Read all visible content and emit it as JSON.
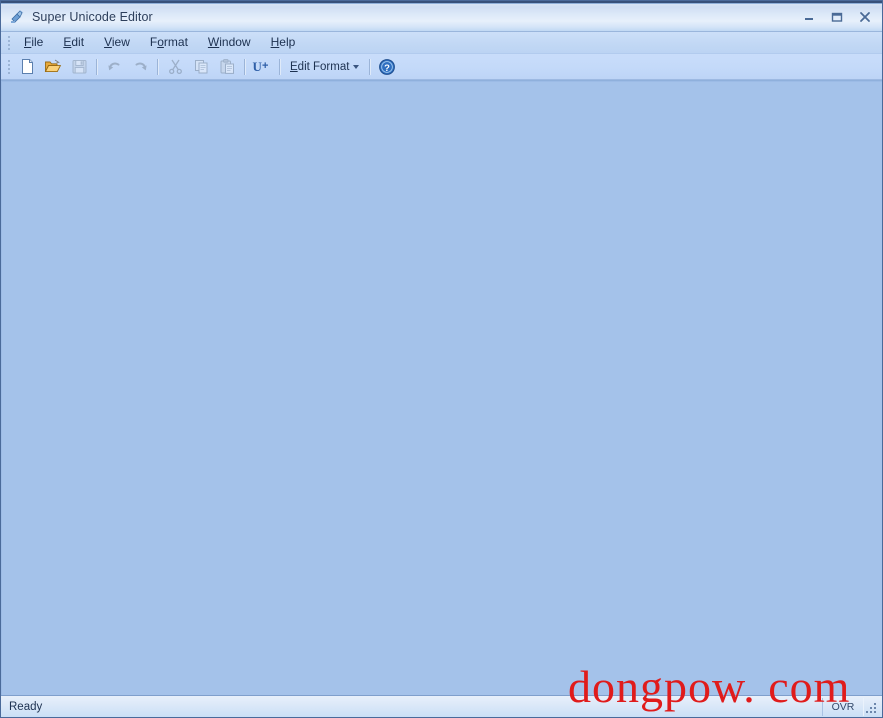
{
  "window": {
    "title": "Super Unicode Editor",
    "icon": "app-icon",
    "controls": [
      {
        "name": "minimize-button",
        "glyph": "minimize"
      },
      {
        "name": "maximize-button",
        "glyph": "maximize"
      },
      {
        "name": "close-button",
        "glyph": "close"
      }
    ]
  },
  "menu": {
    "items": [
      {
        "label": "File",
        "pre": "",
        "accel": "F",
        "post": "ile"
      },
      {
        "label": "Edit",
        "pre": "",
        "accel": "E",
        "post": "dit"
      },
      {
        "label": "View",
        "pre": "",
        "accel": "V",
        "post": "iew"
      },
      {
        "label": "Format",
        "pre": "F",
        "accel": "o",
        "post": "rmat"
      },
      {
        "label": "Window",
        "pre": "",
        "accel": "W",
        "post": "indow"
      },
      {
        "label": "Help",
        "pre": "",
        "accel": "H",
        "post": "elp"
      }
    ]
  },
  "toolbar": {
    "buttons": [
      {
        "name": "new-file-button",
        "icon": "new-document-icon",
        "enabled": true,
        "tooltip": "New"
      },
      {
        "name": "open-file-button",
        "icon": "open-folder-icon",
        "enabled": true,
        "tooltip": "Open"
      },
      {
        "name": "save-file-button",
        "icon": "save-disk-icon",
        "enabled": false,
        "tooltip": "Save"
      },
      {
        "name": "undo-button",
        "icon": "undo-arrow-icon",
        "enabled": false,
        "tooltip": "Undo"
      },
      {
        "name": "redo-button",
        "icon": "redo-arrow-icon",
        "enabled": false,
        "tooltip": "Redo"
      },
      {
        "name": "cut-button",
        "icon": "scissors-icon",
        "enabled": false,
        "tooltip": "Cut"
      },
      {
        "name": "copy-button",
        "icon": "copy-icon",
        "enabled": false,
        "tooltip": "Copy"
      },
      {
        "name": "paste-button",
        "icon": "paste-icon",
        "enabled": false,
        "tooltip": "Paste"
      },
      {
        "name": "unicode-button",
        "icon": "u-plus-icon",
        "enabled": true,
        "tooltip": "U+"
      }
    ],
    "edit_format": {
      "pre": "",
      "accel": "E",
      "post": "dit Format"
    },
    "help_button": {
      "name": "help-button",
      "icon": "help-circle-icon"
    }
  },
  "status": {
    "message": "Ready",
    "panel_ovr": "OVR",
    "grip": "resize-grip"
  },
  "watermark": {
    "text": "dongpow. com"
  },
  "colors": {
    "client_background": "#a4c2ea",
    "title_band": "#dce8f8",
    "toolbar": "#c3d9f9",
    "watermark_red": "#e01b1b",
    "frame_border": "#4a6a9a"
  }
}
